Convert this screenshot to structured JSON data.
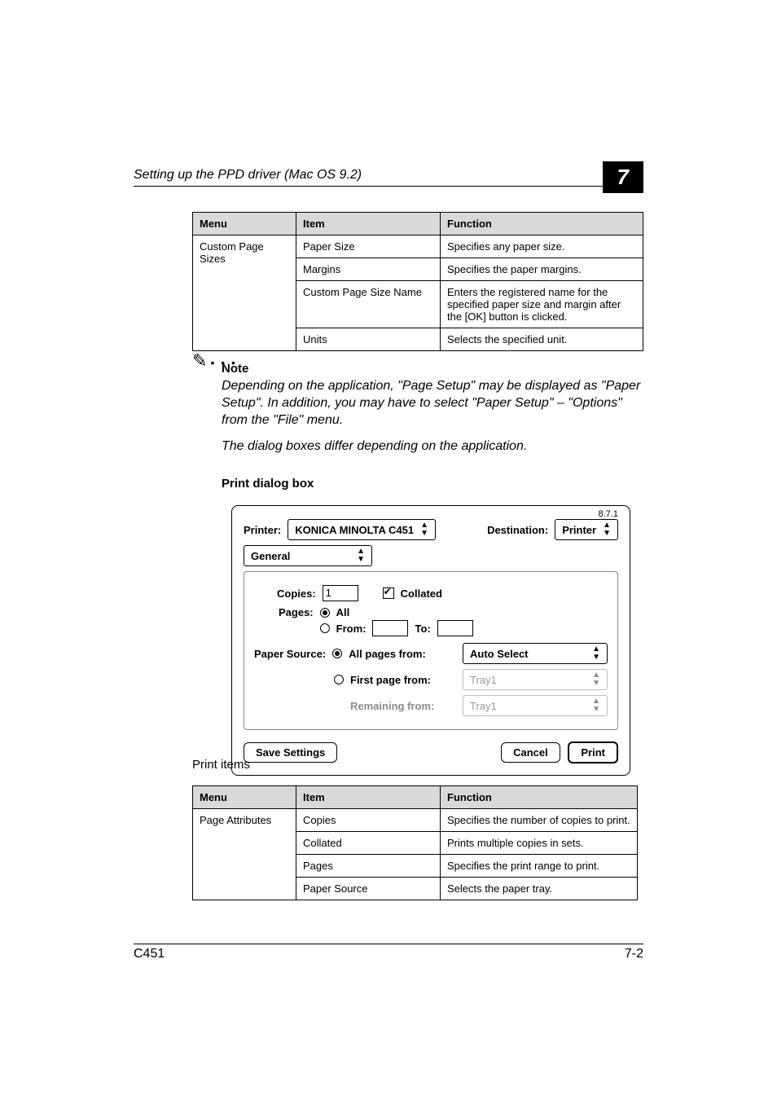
{
  "header": {
    "title": "Setting up the PPD driver (Mac OS 9.2)",
    "chapter": "7"
  },
  "table1": {
    "cols": [
      "Menu",
      "Item",
      "Function"
    ],
    "menu": "Custom Page Sizes",
    "rows": [
      {
        "item": "Paper Size",
        "func": "Specifies any paper size."
      },
      {
        "item": "Margins",
        "func": "Specifies the paper margins."
      },
      {
        "item": "Custom Page Size Name",
        "func": "Enters the registered name for the specified paper size and margin after the [OK] button is clicked."
      },
      {
        "item": "Units",
        "func": "Selects the specified unit."
      }
    ]
  },
  "note": {
    "label": "Note",
    "p1": "Depending on the application, \"Page Setup\" may be displayed as \"Paper Setup\". In addition, you may have to select \"Paper Setup\" – \"Options\" from the \"File\" menu.",
    "p2": "The dialog boxes differ depending on the application."
  },
  "subhead": "Print dialog box",
  "dialog": {
    "version": "8.7.1",
    "printer_label": "Printer:",
    "printer_value": "KONICA MINOLTA C451",
    "destination_label": "Destination:",
    "destination_value": "Printer",
    "panel": "General",
    "copies_label": "Copies:",
    "copies_value": "1",
    "collated_label": "Collated",
    "pages_label": "Pages:",
    "pages_all": "All",
    "pages_from": "From:",
    "pages_to": "To:",
    "source_label": "Paper Source:",
    "source_all": "All pages from:",
    "source_all_value": "Auto Select",
    "source_first": "First page from:",
    "source_first_value": "Tray1",
    "source_remaining": "Remaining from:",
    "source_remaining_value": "Tray1",
    "save": "Save Settings",
    "cancel": "Cancel",
    "print": "Print"
  },
  "items_label": "Print items",
  "table2": {
    "cols": [
      "Menu",
      "Item",
      "Function"
    ],
    "menu": "Page Attributes",
    "rows": [
      {
        "item": "Copies",
        "func": "Specifies the number of copies to print."
      },
      {
        "item": "Collated",
        "func": "Prints multiple copies in sets."
      },
      {
        "item": "Pages",
        "func": "Specifies the print range to print."
      },
      {
        "item": "Paper Source",
        "func": "Selects the paper tray."
      }
    ]
  },
  "footer": {
    "left": "C451",
    "right": "7-2"
  }
}
